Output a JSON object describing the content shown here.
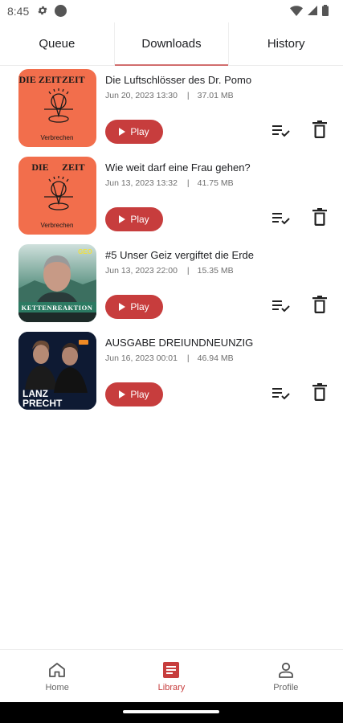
{
  "status_bar": {
    "time": "8:45"
  },
  "tabs": [
    {
      "label": "Queue",
      "active": false
    },
    {
      "label": "Downloads",
      "active": true
    },
    {
      "label": "History",
      "active": false
    }
  ],
  "episodes": [
    {
      "title": "Die Luftschlösser des Dr. Pomo",
      "date": "Jun 20, 2023 13:30",
      "size": "37.01 MB",
      "play_label": "Play",
      "cover": {
        "brand": "DIE ZEIT",
        "caption": "Verbrechen",
        "bg": "#f26e4c"
      }
    },
    {
      "title": "Wie weit darf eine Frau gehen?",
      "date": "Jun 13, 2023 13:32",
      "size": "41.75 MB",
      "play_label": "Play",
      "cover": {
        "brand": "DIE ZEIT",
        "caption": "Verbrechen",
        "bg": "#f26e4c"
      }
    },
    {
      "title": "#5 Unser Geiz vergiftet die Erde",
      "date": "Jun 13, 2023 22:00",
      "size": "15.35 MB",
      "play_label": "Play",
      "cover": {
        "brand": "GEO",
        "caption": "KETTENREAKTION",
        "bg": "#3f7a6a"
      }
    },
    {
      "title": "AUSGABE DREIUNDNEUNZIG",
      "date": "Jun 16, 2023 00:01",
      "size": "46.94 MB",
      "play_label": "Play",
      "cover": {
        "brand": "LANZ & PRECHT",
        "caption": "",
        "bg": "#0e1a33"
      }
    }
  ],
  "bottom_nav": [
    {
      "label": "Home",
      "icon": "home-icon",
      "active": false
    },
    {
      "label": "Library",
      "icon": "library-icon",
      "active": true
    },
    {
      "label": "Profile",
      "icon": "profile-icon",
      "active": false
    }
  ],
  "colors": {
    "accent": "#c73d3d",
    "tab_indicator": "#d16e6e",
    "zeit_orange": "#f26e4c"
  }
}
